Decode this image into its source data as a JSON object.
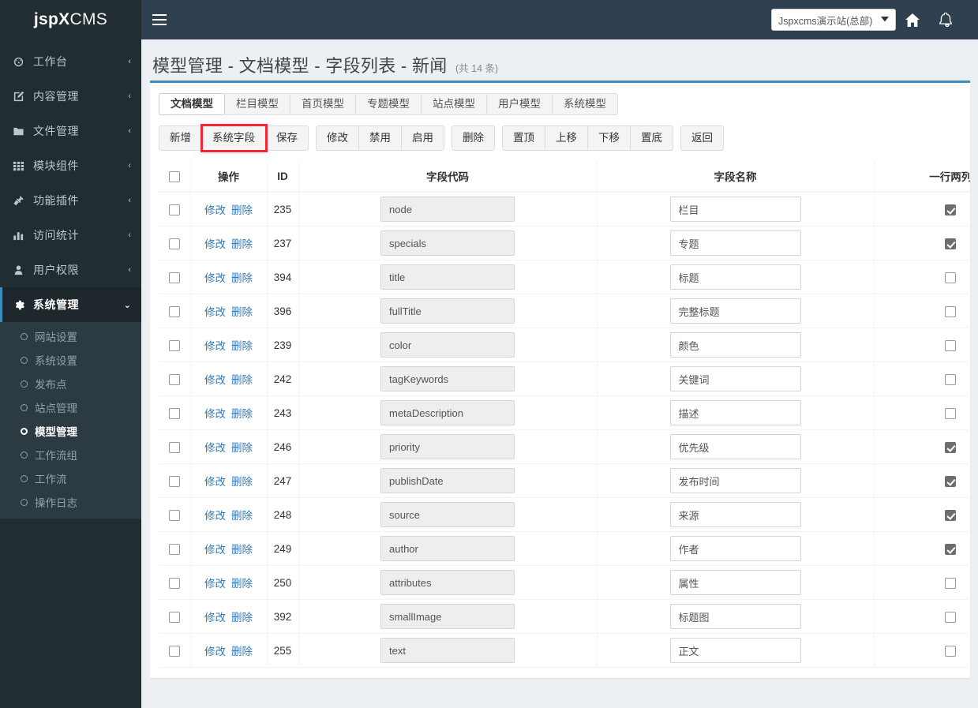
{
  "brand": {
    "strong": "jspX",
    "light": "CMS"
  },
  "topbar": {
    "menu_toggle": "☰",
    "site_selector": {
      "value": "Jspxcms演示站(总部)",
      "caret": "▼"
    },
    "home_icon": "home-icon",
    "bell_icon": "bell-icon"
  },
  "sidebar": {
    "items": [
      {
        "label": "工作台",
        "icon": "dashboard-icon",
        "arrow": "‹",
        "active": false
      },
      {
        "label": "内容管理",
        "icon": "edit-icon",
        "arrow": "‹",
        "active": false
      },
      {
        "label": "文件管理",
        "icon": "folder-icon",
        "arrow": "‹",
        "active": false
      },
      {
        "label": "模块组件",
        "icon": "grid-icon",
        "arrow": "‹",
        "active": false
      },
      {
        "label": "功能插件",
        "icon": "plug-icon",
        "arrow": "‹",
        "active": false
      },
      {
        "label": "访问统计",
        "icon": "chart-bar-icon",
        "arrow": "‹",
        "active": false
      },
      {
        "label": "用户权限",
        "icon": "user-icon",
        "arrow": "‹",
        "active": false
      },
      {
        "label": "系统管理",
        "icon": "gear-icon",
        "arrow": "⌄",
        "active": true
      }
    ],
    "submenu": [
      {
        "label": "网站设置",
        "active": false
      },
      {
        "label": "系统设置",
        "active": false
      },
      {
        "label": "发布点",
        "active": false
      },
      {
        "label": "站点管理",
        "active": false
      },
      {
        "label": "模型管理",
        "active": true
      },
      {
        "label": "工作流组",
        "active": false
      },
      {
        "label": "工作流",
        "active": false
      },
      {
        "label": "操作日志",
        "active": false
      }
    ]
  },
  "page": {
    "title": "模型管理 - 文档模型 - 字段列表 - 新闻",
    "count": "(共 14 条)"
  },
  "tabs": [
    {
      "label": "文档模型",
      "active": true
    },
    {
      "label": "栏目模型",
      "active": false
    },
    {
      "label": "首页模型",
      "active": false
    },
    {
      "label": "专题模型",
      "active": false
    },
    {
      "label": "站点模型",
      "active": false
    },
    {
      "label": "用户模型",
      "active": false
    },
    {
      "label": "系统模型",
      "active": false
    }
  ],
  "toolbar_groups": [
    {
      "buttons": [
        {
          "label": "新增",
          "highlight": false
        },
        {
          "label": "系统字段",
          "highlight": true
        },
        {
          "label": "保存",
          "highlight": false
        }
      ]
    },
    {
      "buttons": [
        {
          "label": "修改",
          "highlight": false
        },
        {
          "label": "禁用",
          "highlight": false
        },
        {
          "label": "启用",
          "highlight": false
        }
      ]
    },
    {
      "buttons": [
        {
          "label": "删除",
          "highlight": false
        }
      ]
    },
    {
      "buttons": [
        {
          "label": "置顶",
          "highlight": false
        },
        {
          "label": "上移",
          "highlight": false
        },
        {
          "label": "下移",
          "highlight": false
        },
        {
          "label": "置底",
          "highlight": false
        }
      ]
    },
    {
      "buttons": [
        {
          "label": "返回",
          "highlight": false
        }
      ]
    }
  ],
  "table": {
    "headers": {
      "select_all": "",
      "operation": "操作",
      "id": "ID",
      "code": "字段代码",
      "name": "字段名称",
      "two_col": "一行两列"
    },
    "row_actions": {
      "edit": "修改",
      "delete": "删除"
    },
    "rows": [
      {
        "checked": false,
        "id": "235",
        "code": "node",
        "name": "栏目",
        "two_col": true
      },
      {
        "checked": false,
        "id": "237",
        "code": "specials",
        "name": "专题",
        "two_col": true
      },
      {
        "checked": false,
        "id": "394",
        "code": "title",
        "name": "标题",
        "two_col": false
      },
      {
        "checked": false,
        "id": "396",
        "code": "fullTitle",
        "name": "完整标题",
        "two_col": false
      },
      {
        "checked": false,
        "id": "239",
        "code": "color",
        "name": "颜色",
        "two_col": false
      },
      {
        "checked": false,
        "id": "242",
        "code": "tagKeywords",
        "name": "关键词",
        "two_col": false
      },
      {
        "checked": false,
        "id": "243",
        "code": "metaDescription",
        "name": "描述",
        "two_col": false
      },
      {
        "checked": false,
        "id": "246",
        "code": "priority",
        "name": "优先级",
        "two_col": true
      },
      {
        "checked": false,
        "id": "247",
        "code": "publishDate",
        "name": "发布时间",
        "two_col": true
      },
      {
        "checked": false,
        "id": "248",
        "code": "source",
        "name": "来源",
        "two_col": true
      },
      {
        "checked": false,
        "id": "249",
        "code": "author",
        "name": "作者",
        "two_col": true
      },
      {
        "checked": false,
        "id": "250",
        "code": "attributes",
        "name": "属性",
        "two_col": false
      },
      {
        "checked": false,
        "id": "392",
        "code": "smallImage",
        "name": "标题图",
        "two_col": false
      },
      {
        "checked": false,
        "id": "255",
        "code": "text",
        "name": "正文",
        "two_col": false
      }
    ]
  },
  "colors": {
    "sidebar_bg": "#222d32",
    "submenu_bg": "#2c3b41",
    "topbar_bg": "#2f4050",
    "accent": "#3c8dbc",
    "content_bg": "#ecf0f5",
    "link": "#337ab7",
    "highlight_outline": "#f42534"
  }
}
